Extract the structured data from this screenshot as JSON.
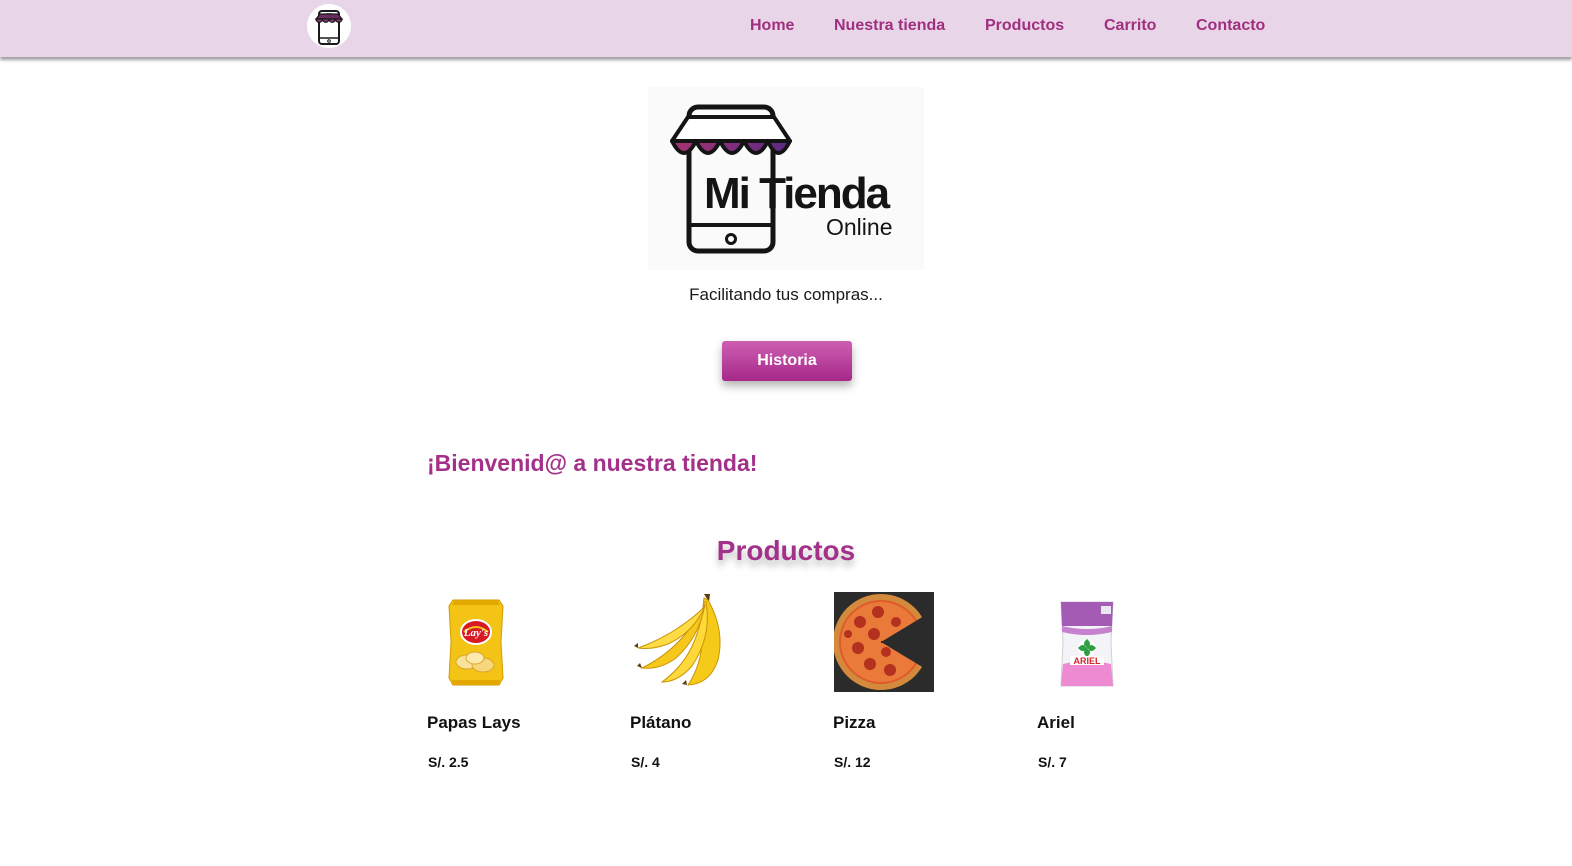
{
  "nav": {
    "logo_icon": "store-phone-icon",
    "links": [
      "Home",
      "Nuestra tienda",
      "Productos",
      "Carrito",
      "Contacto"
    ]
  },
  "hero": {
    "logo_text": "Mi Tienda",
    "logo_subtext": "Online",
    "tagline": "Facilitando tus compras...",
    "button_label": "Historia"
  },
  "welcome": "¡Bienvenid@ a nuestra tienda!",
  "products_title": "Productos",
  "products": [
    {
      "name": "Papas Lays",
      "price": "S/. 2.5",
      "image": "chips-bag-image"
    },
    {
      "name": "Plátano",
      "price": "S/. 4",
      "image": "banana-image"
    },
    {
      "name": "Pizza",
      "price": "S/. 12",
      "image": "pizza-image"
    },
    {
      "name": "Ariel",
      "price": "S/. 7",
      "image": "detergent-bag-image"
    }
  ],
  "colors": {
    "accent": "#a3318a",
    "navbar_bg": "#e8d5e8",
    "button_top": "#cd5fb2",
    "button_bottom": "#a6288a"
  }
}
